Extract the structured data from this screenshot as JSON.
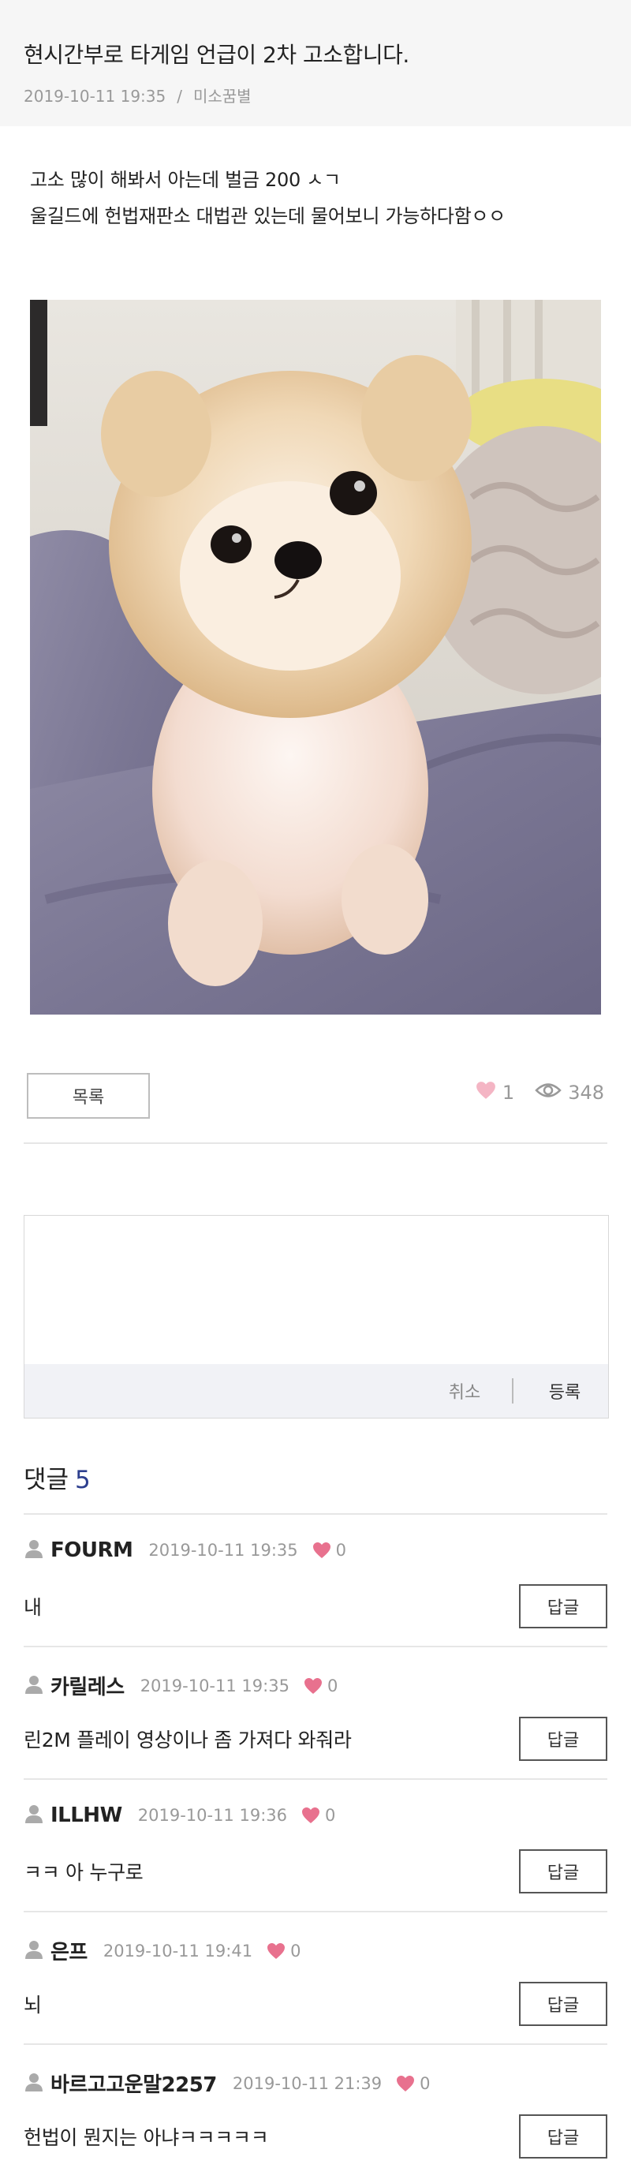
{
  "post": {
    "title": "현시간부로 타게임 언급이 2차 고소합니다.",
    "date": "2019-10-11 19:35",
    "separator": "/",
    "author": "미소꿈별",
    "body_line1": "고소 많이 해봐서 아는데 벌금 200 ㅅㄱ",
    "body_line2": "울길드에 헌법재판소 대법관 있는데 물어보니 가능하다함ㅇㅇ",
    "image_alt": "pomeranian-puppy-photo",
    "likes": "1",
    "views": "348",
    "list_button": "목록"
  },
  "comment_form": {
    "cancel_label": "취소",
    "submit_label": "등록"
  },
  "comments_section": {
    "heading": "댓글",
    "count": "5"
  },
  "comments": [
    {
      "author": "FOURM",
      "date": "2019-10-11 19:35",
      "likes": "0",
      "text": "내",
      "reply_label": "답글"
    },
    {
      "author": "카릴레스",
      "date": "2019-10-11 19:35",
      "likes": "0",
      "text": "린2M 플레이 영상이나 좀 가져다 와줘라",
      "reply_label": "답글"
    },
    {
      "author": "ILLHW",
      "date": "2019-10-11 19:36",
      "likes": "0",
      "text": "ㅋㅋ 아 누구로",
      "reply_label": "답글"
    },
    {
      "author": "은프",
      "date": "2019-10-11 19:41",
      "likes": "0",
      "text": "뇌",
      "reply_label": "답글"
    },
    {
      "author": "바르고고운말2257",
      "date": "2019-10-11 21:39",
      "likes": "0",
      "text": "헌법이 뭔지는 아냐ㅋㅋㅋㅋㅋ",
      "reply_label": "답글"
    }
  ],
  "colors": {
    "accent_heart": "#e8718e",
    "heart_light": "#f4b5c4",
    "count_blue": "#2d3f8e"
  }
}
